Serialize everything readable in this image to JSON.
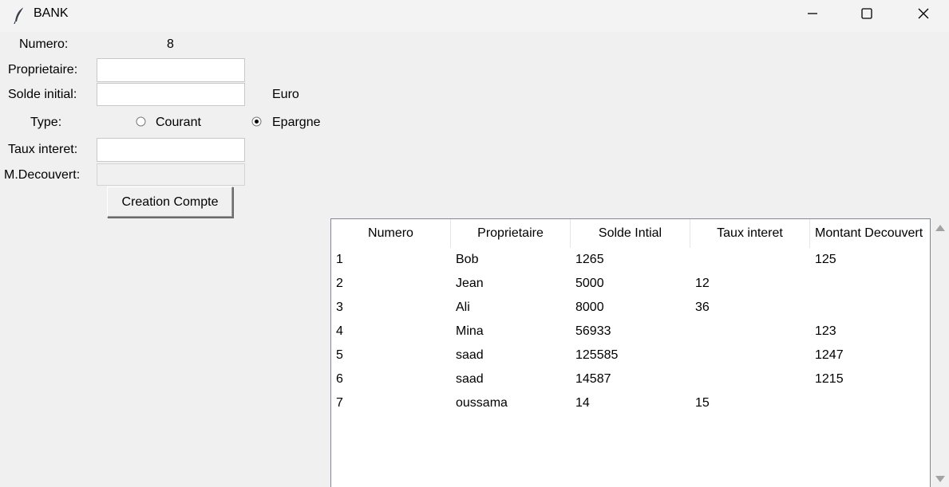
{
  "window": {
    "title": "BANK",
    "icon": "feather-icon",
    "controls": [
      "minimize-icon",
      "maximize-icon",
      "close-icon"
    ]
  },
  "form": {
    "numero_label": "Numero:",
    "numero_value": "8",
    "proprietaire_label": "Proprietaire:",
    "proprietaire_value": "",
    "solde_label": "Solde initial:",
    "solde_value": "",
    "currency_label": "Euro",
    "type_label": "Type:",
    "type_options": [
      {
        "label": "Courant",
        "selected": false
      },
      {
        "label": "Epargne",
        "selected": true
      }
    ],
    "taux_label": "Taux interet:",
    "taux_value": "",
    "decouvert_label": "M.Decouvert:",
    "decouvert_value": "",
    "create_button": "Creation Compte"
  },
  "table": {
    "columns": [
      "Numero",
      "Proprietaire",
      "Solde Intial",
      "Taux interet",
      "Montant Decouvert"
    ],
    "rows": [
      [
        "1",
        "Bob",
        "1265",
        "",
        "125"
      ],
      [
        "2",
        "Jean",
        "5000",
        "12",
        ""
      ],
      [
        "3",
        "Ali",
        "8000",
        "36",
        ""
      ],
      [
        "4",
        "Mina",
        "56933",
        "",
        "123"
      ],
      [
        "5",
        "saad",
        "125585",
        "",
        "1247"
      ],
      [
        "6",
        "saad",
        "14587",
        "",
        "1215"
      ],
      [
        "7",
        "oussama",
        "14",
        "15",
        ""
      ]
    ]
  },
  "colors": {
    "window_bg": "#f0f0f0",
    "entry_bg": "#ffffff",
    "tree_bg": "#ffffff"
  }
}
